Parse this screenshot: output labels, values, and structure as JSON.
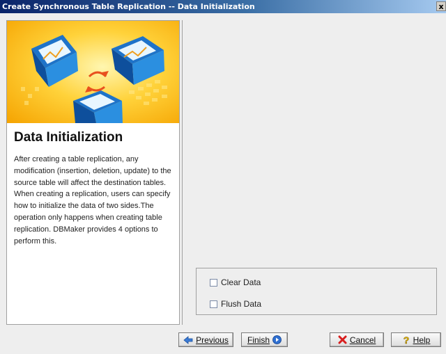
{
  "window": {
    "title": "Create Synchronous Table Replication -- Data Initialization",
    "close_glyph": "x"
  },
  "left": {
    "heading": "Data Initialization",
    "description": "After creating a table replication, any modification (insertion, deletion, update) to the source table will affect the destination tables. When creating a replication, users can specify how to initialize the data of two sides.The operation only happens when creating table replication. DBMaker provides 4 options to perform this."
  },
  "options": [
    {
      "label": "Clear Data",
      "checked": false
    },
    {
      "label": "Flush Data",
      "checked": false
    }
  ],
  "buttons": {
    "previous": "Previous",
    "finish": "Finish",
    "cancel": "Cancel",
    "help": "Help"
  },
  "icons": {
    "banner": "database-replication-illustration",
    "previous": "back-arrow-icon",
    "finish": "finish-icon",
    "cancel": "red-x-icon",
    "help": "question-mark-icon"
  },
  "colors": {
    "banner_accent": "#ffd23a",
    "title_bar": "#0a246a"
  }
}
